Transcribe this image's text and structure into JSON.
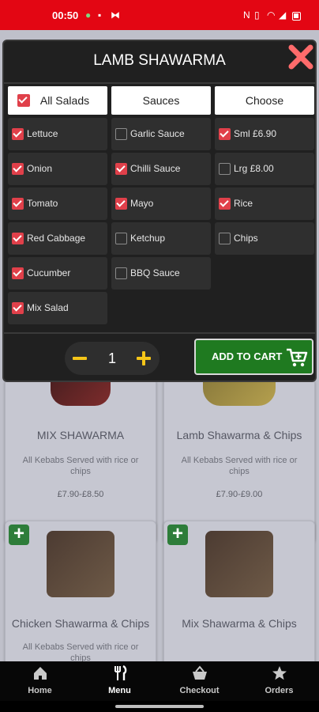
{
  "status_bar": {
    "time": "00:50",
    "icons": [
      "whatsapp-icon",
      "media-icon",
      "nfc-icon",
      "vibrate-icon",
      "wifi-icon",
      "signal-icon",
      "battery-icon"
    ]
  },
  "modal": {
    "title": "LAMB SHAWARMA",
    "columns": [
      {
        "header": "All Salads",
        "header_checked": true,
        "options": [
          {
            "label": "Lettuce",
            "checked": true
          },
          {
            "label": "Onion",
            "checked": true
          },
          {
            "label": "Tomato",
            "checked": true
          },
          {
            "label": "Red Cabbage",
            "checked": true
          },
          {
            "label": "Cucumber",
            "checked": true
          },
          {
            "label": "Mix Salad",
            "checked": true
          }
        ]
      },
      {
        "header": "Sauces",
        "options": [
          {
            "label": "Garlic Sauce",
            "checked": false
          },
          {
            "label": "Chilli Sauce",
            "checked": true
          },
          {
            "label": "Mayo",
            "checked": true
          },
          {
            "label": "Ketchup",
            "checked": false
          },
          {
            "label": "BBQ Sauce",
            "checked": false
          }
        ]
      },
      {
        "header": "Choose",
        "options": [
          {
            "label": "Sml £6.90",
            "checked": true
          },
          {
            "label": "Lrg £8.00",
            "checked": false
          },
          {
            "label": "Rice",
            "checked": true
          },
          {
            "label": "Chips",
            "checked": false
          }
        ]
      }
    ],
    "quantity": "1",
    "add_to_cart_label": "ADD TO CART"
  },
  "menu_items": [
    {
      "name": "MIX SHAWARMA",
      "description": "All Kebabs Served with rice or chips",
      "price": "£7.90-£8.50"
    },
    {
      "name": "Lamb Shawarma & Chips",
      "description": "All Kebabs Served with rice or chips",
      "price": "£7.90-£9.00"
    },
    {
      "name": "Chicken Shawarma & Chips",
      "description": "All Kebabs Served with rice or chips",
      "price": ""
    },
    {
      "name": "Mix Shawarma & Chips",
      "description": "",
      "price": ""
    }
  ],
  "bottom_nav": [
    {
      "label": "Home",
      "icon": "home-icon",
      "active": false
    },
    {
      "label": "Menu",
      "icon": "fork-knife-icon",
      "active": true
    },
    {
      "label": "Checkout",
      "icon": "basket-icon",
      "active": false
    },
    {
      "label": "Orders",
      "icon": "star-icon",
      "active": false
    }
  ],
  "colors": {
    "status_bar": "#e30613",
    "checkbox": "#e0404a",
    "add_to_cart": "#1f7a20",
    "qty_icons": "#f5c518",
    "close": "#ff6b6b"
  }
}
